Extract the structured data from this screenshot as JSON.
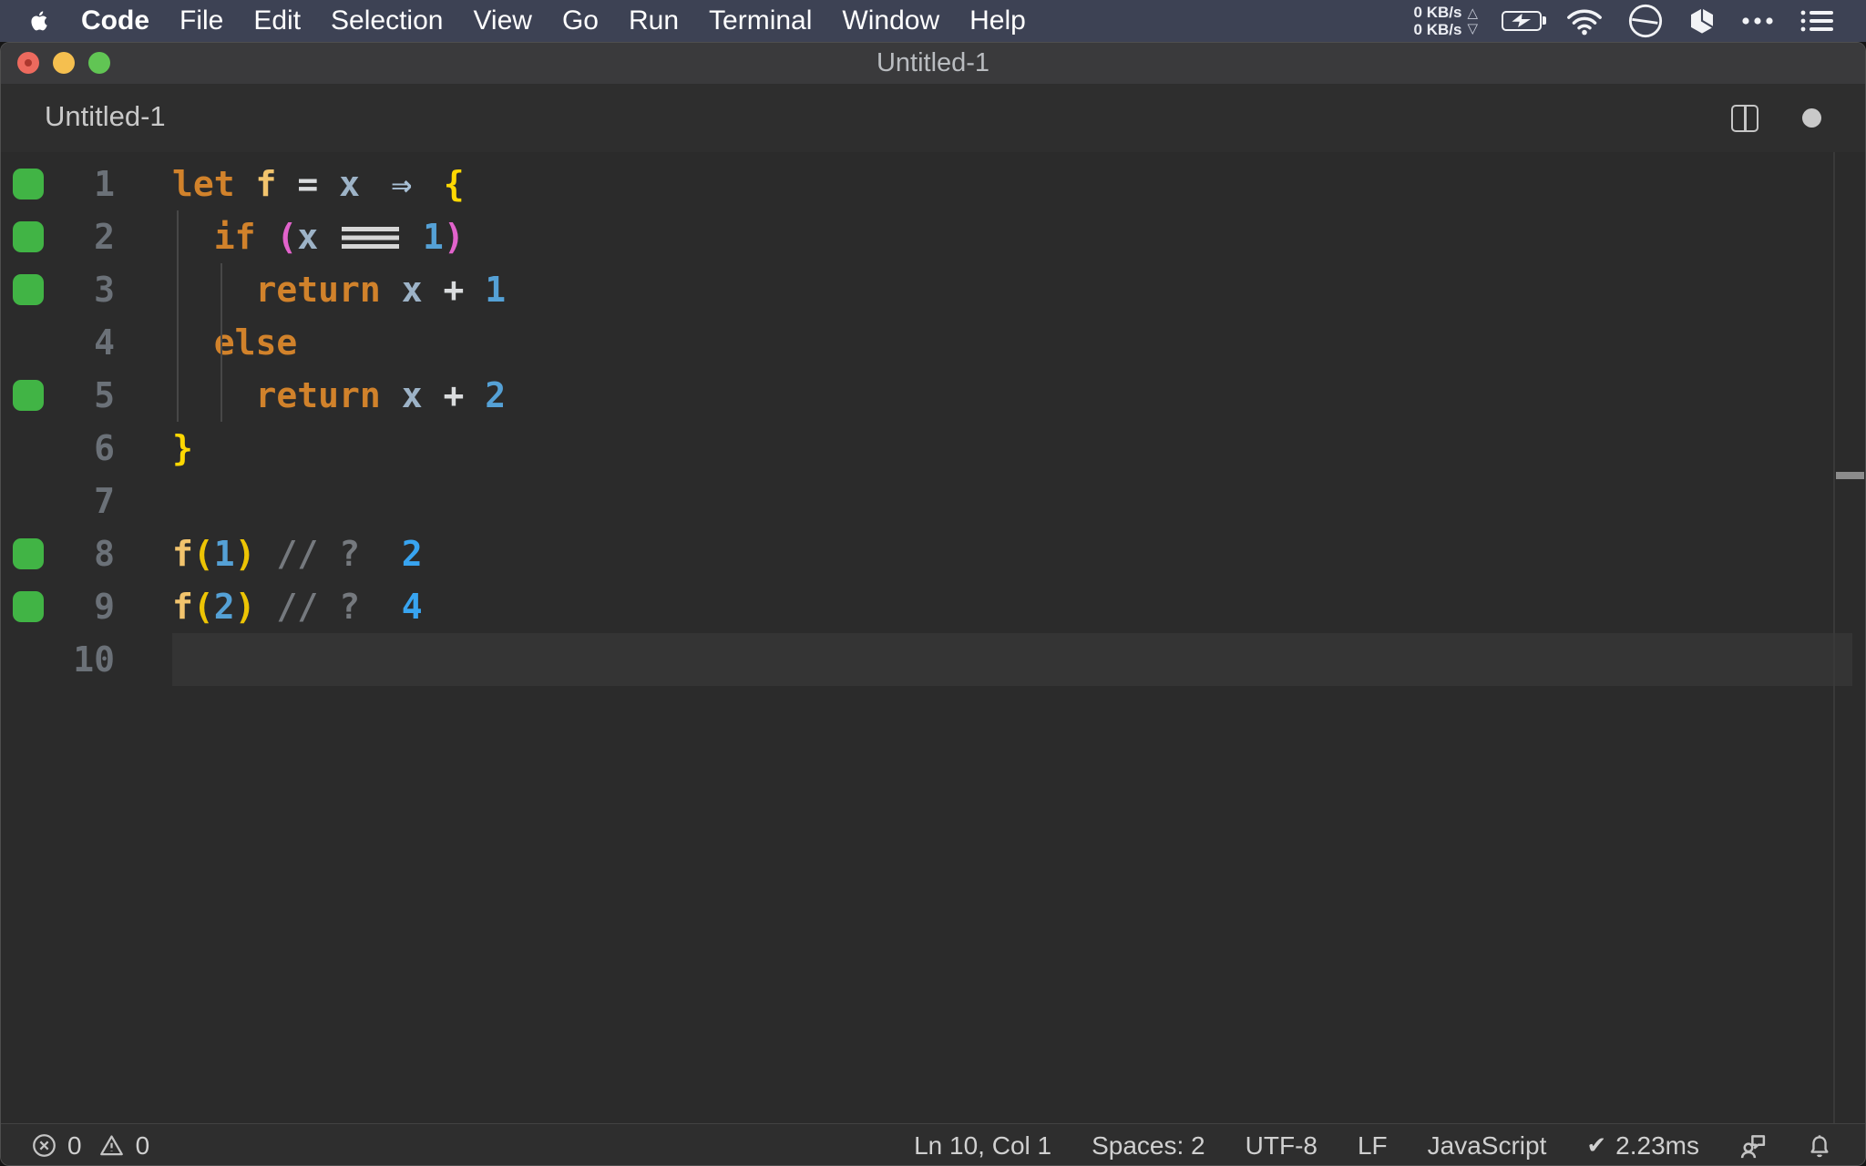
{
  "menubar": {
    "items": [
      {
        "label": "Code",
        "bold": true
      },
      {
        "label": "File"
      },
      {
        "label": "Edit"
      },
      {
        "label": "Selection"
      },
      {
        "label": "View"
      },
      {
        "label": "Go"
      },
      {
        "label": "Run"
      },
      {
        "label": "Terminal"
      },
      {
        "label": "Window"
      },
      {
        "label": "Help"
      }
    ],
    "net_up": "0 KB/s",
    "net_down": "0 KB/s",
    "net_up_arrow": "△",
    "net_down_arrow": "▽"
  },
  "titlebar": {
    "title": "Untitled-1"
  },
  "tabbar": {
    "tab_title": "Untitled-1"
  },
  "editor": {
    "lines": [
      {
        "n": "1",
        "cov": true,
        "guides": [],
        "tokens": [
          [
            "kw",
            "let"
          ],
          [
            "pl",
            " "
          ],
          [
            "fn",
            "f"
          ],
          [
            "pl",
            " "
          ],
          [
            "op",
            "="
          ],
          [
            "pl",
            " "
          ],
          [
            "var",
            "x"
          ],
          [
            "pl",
            " "
          ],
          [
            "arrow",
            "⇒"
          ],
          [
            "pl",
            " "
          ],
          [
            "by",
            "{"
          ]
        ]
      },
      {
        "n": "2",
        "cov": true,
        "guides": [
          5
        ],
        "tokens": [
          [
            "pl",
            "  "
          ],
          [
            "kw",
            "if"
          ],
          [
            "pl",
            " "
          ],
          [
            "pm",
            "("
          ],
          [
            "var",
            "x"
          ],
          [
            "pl",
            " "
          ],
          [
            "lig3",
            ""
          ],
          [
            "pl",
            " "
          ],
          [
            "num",
            "1"
          ],
          [
            "pm",
            ")"
          ]
        ]
      },
      {
        "n": "3",
        "cov": true,
        "guides": [
          5,
          53
        ],
        "tokens": [
          [
            "pl",
            "    "
          ],
          [
            "kw",
            "return"
          ],
          [
            "pl",
            " "
          ],
          [
            "var",
            "x"
          ],
          [
            "pl",
            " "
          ],
          [
            "op",
            "+"
          ],
          [
            "pl",
            " "
          ],
          [
            "num",
            "1"
          ]
        ]
      },
      {
        "n": "4",
        "cov": false,
        "guides": [
          5,
          53
        ],
        "tokens": [
          [
            "pl",
            "  "
          ],
          [
            "kw",
            "else"
          ]
        ]
      },
      {
        "n": "5",
        "cov": true,
        "guides": [
          5,
          53
        ],
        "tokens": [
          [
            "pl",
            "    "
          ],
          [
            "kw",
            "return"
          ],
          [
            "pl",
            " "
          ],
          [
            "var",
            "x"
          ],
          [
            "pl",
            " "
          ],
          [
            "op",
            "+"
          ],
          [
            "pl",
            " "
          ],
          [
            "num",
            "2"
          ]
        ]
      },
      {
        "n": "6",
        "cov": false,
        "guides": [],
        "tokens": [
          [
            "by",
            "}"
          ]
        ]
      },
      {
        "n": "7",
        "cov": false,
        "guides": [],
        "tokens": []
      },
      {
        "n": "8",
        "cov": true,
        "guides": [],
        "tokens": [
          [
            "fn",
            "f"
          ],
          [
            "py",
            "("
          ],
          [
            "num",
            "1"
          ],
          [
            "py",
            ")"
          ],
          [
            "pl",
            " "
          ],
          [
            "cm",
            "// ?"
          ],
          [
            "pl",
            "  "
          ],
          [
            "res",
            "2"
          ]
        ]
      },
      {
        "n": "9",
        "cov": true,
        "guides": [],
        "tokens": [
          [
            "fn",
            "f"
          ],
          [
            "py",
            "("
          ],
          [
            "num",
            "2"
          ],
          [
            "py",
            ")"
          ],
          [
            "pl",
            " "
          ],
          [
            "cm",
            "// ?"
          ],
          [
            "pl",
            "  "
          ],
          [
            "res",
            "4"
          ]
        ]
      },
      {
        "n": "10",
        "cov": false,
        "guides": [],
        "current": true,
        "tokens": []
      }
    ]
  },
  "statusbar": {
    "errors": "0",
    "warnings": "0",
    "ln_col": "Ln 10, Col 1",
    "spaces": "Spaces: 2",
    "encoding": "UTF-8",
    "eol": "LF",
    "language": "JavaScript",
    "check_glyph": "✔",
    "perf_time": "2.23ms"
  },
  "colors": {
    "menubar_bg": "#3d4254",
    "editor_bg": "#2b2b2b",
    "titlebar_bg": "#3a3a3c",
    "coverage_green": "#41b445",
    "keyword_orange": "#d1822b",
    "function_gold": "#f2c46d",
    "variable_blue_gray": "#9db3c7",
    "number_blue": "#55a1d6",
    "result_blue": "#38a4f0",
    "brace_yellow": "#fed802",
    "paren_magenta": "#e263cc",
    "paren_gold": "#edc404",
    "comment_gray": "#75797e",
    "traffic_red": "#ed6a5e",
    "traffic_yellow": "#f5bf4f",
    "traffic_green": "#61c554"
  }
}
